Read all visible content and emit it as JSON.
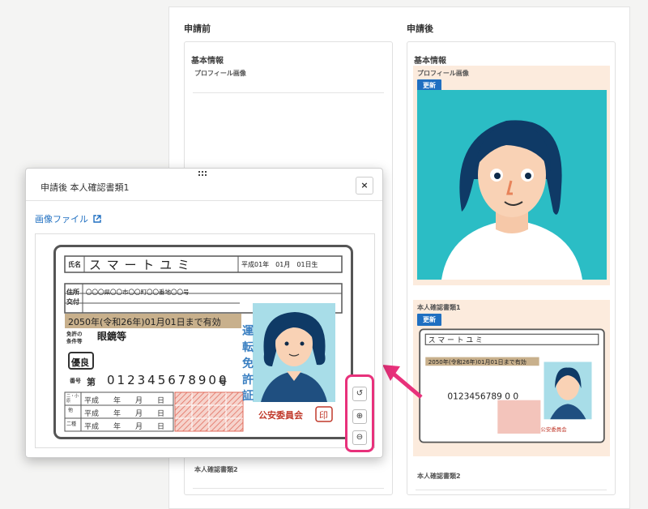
{
  "columns": {
    "before_title": "申請前",
    "after_title": "申請後"
  },
  "before": {
    "section_title": "基本情報",
    "profile_label": "プロフィール画像",
    "doc2_label": "本人確認書類2"
  },
  "after": {
    "section_title": "基本情報",
    "profile_label": "プロフィール画像",
    "profile_badge": "更新",
    "doc1_label": "本人確認書類1",
    "doc1_badge": "更新",
    "doc2_label": "本人確認書類2"
  },
  "modal": {
    "title": "申請後 本人確認書類1",
    "close_label": "×",
    "image_link": "画像ファイル",
    "link_icon": "external-link-icon",
    "tools": [
      {
        "name": "rotate-icon",
        "glyph": "↺"
      },
      {
        "name": "zoom-in-icon",
        "glyph": "⊕"
      },
      {
        "name": "zoom-out-icon",
        "glyph": "⊖"
      }
    ]
  },
  "license": {
    "name_label": "氏名",
    "name": "ス マ ー ト ユ ミ",
    "birth": "平成01年　01月　01日生",
    "address_label": "住所",
    "address": "〇〇〇県〇〇市〇〇町〇〇番地〇〇号",
    "issue_label": "交付",
    "validity": "2050年(令和26年)01月01日まで有効",
    "condition_label": "免許の\n条件等",
    "condition": "眼鏡等",
    "grade": "優良",
    "number_label": "番号",
    "number_prefix": "第",
    "number": "012345678900",
    "number_suffix": "号",
    "cat1": "二・小\n原",
    "cat2": "他",
    "cat3": "二種",
    "row1": "平成　　年　　月　　日",
    "row2": "平成　　年　　月　　日",
    "row3": "平成　　年　　月　　日",
    "side_text": [
      "運",
      "転",
      "免",
      "許",
      "証"
    ],
    "issuer": "公安委員会",
    "seal": "印"
  },
  "colors": {
    "accent_blue": "#1f6fc1",
    "highlight_pink": "#e8317b",
    "teal": "#2bbdc5",
    "peach": "#fcebdd",
    "validity_band": "#c8b08c",
    "hatch_red": "#e06a5a"
  }
}
